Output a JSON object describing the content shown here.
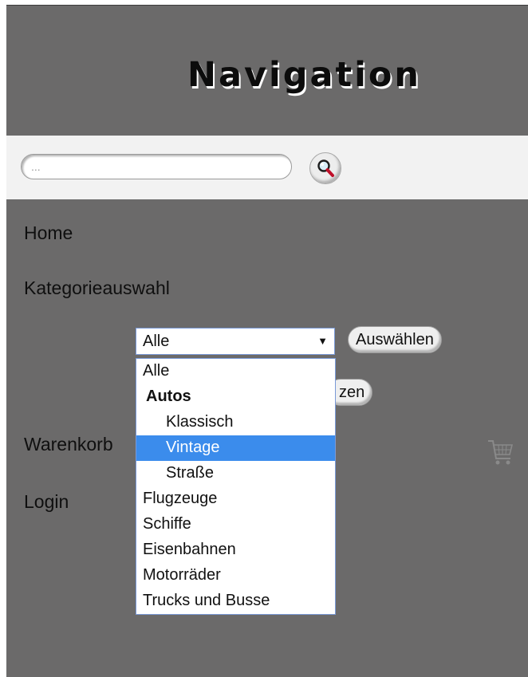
{
  "header": {
    "title": "Navigation"
  },
  "search": {
    "placeholder": "...",
    "button_icon": "magnifier-icon"
  },
  "menu": {
    "home": "Home",
    "category": "Kategorieauswahl",
    "cart": "Warenkorb",
    "login": "Login",
    "cart_icon": "shopping-cart-icon"
  },
  "category_select": {
    "selected": "Alle",
    "select_button": "Auswählen",
    "reset_button_partial": "zen",
    "options": [
      {
        "label": "Alle",
        "kind": "top"
      },
      {
        "label": "Autos",
        "kind": "group"
      },
      {
        "label": "Klassisch",
        "kind": "child"
      },
      {
        "label": "Vintage",
        "kind": "child",
        "highlighted": true
      },
      {
        "label": "Straße",
        "kind": "child"
      },
      {
        "label": "Flugzeuge",
        "kind": "top"
      },
      {
        "label": "Schiffe",
        "kind": "top"
      },
      {
        "label": "Eisenbahnen",
        "kind": "top"
      },
      {
        "label": "Motorräder",
        "kind": "top"
      },
      {
        "label": "Trucks und Busse",
        "kind": "top"
      }
    ]
  },
  "colors": {
    "panel": "#6b6a6a",
    "highlight": "#3b8cec",
    "search_bar": "#f2f2f2"
  }
}
